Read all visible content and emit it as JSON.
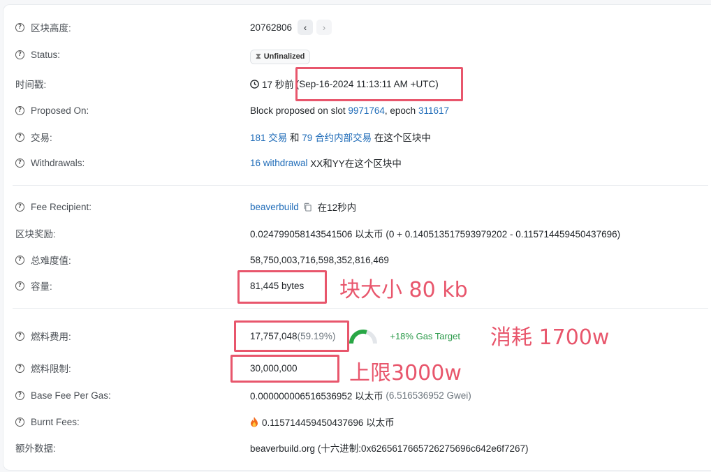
{
  "rows": {
    "block_height": {
      "label": "区块高度:",
      "value": "20762806",
      "prev_icon": "chevron-left-icon",
      "next_icon": "chevron-right-icon"
    },
    "status": {
      "label": "Status:",
      "badge": "Unfinalized",
      "badge_icon": "hourglass-icon"
    },
    "timestamp": {
      "label": "时间戳:",
      "ago": "17 秒前",
      "utc": "(Sep-16-2024 11:13:11 AM +UTC)"
    },
    "proposed_on": {
      "label": "Proposed On:",
      "prefix": "Block proposed on slot ",
      "slot": "9971764",
      "mid": ", epoch ",
      "epoch": "311617"
    },
    "transactions": {
      "label": "交易:",
      "tx_link": "181 交易",
      "and": " 和 ",
      "internal_link": "79 合约内部交易",
      "suffix": " 在这个区块中"
    },
    "withdrawals": {
      "label": "Withdrawals:",
      "link": "16 withdrawal",
      "suffix": " XX和YY在这个区块中"
    },
    "fee_recipient": {
      "label": "Fee Recipient:",
      "link": "beaverbuild",
      "suffix": " 在12秒内"
    },
    "block_reward": {
      "label": "区块奖励:",
      "value": "0.024799058143541506 以太币 (0 + 0.140513517593979202 - 0.115714459450437696)"
    },
    "total_difficulty": {
      "label": "总难度值:",
      "value": "58,750,003,716,598,352,816,469"
    },
    "size": {
      "label": "容量:",
      "value": "81,445 bytes"
    },
    "gas_used": {
      "label": "燃料费用:",
      "value": "17,757,048",
      "pct": "(59.19%)",
      "target": "+18% Gas Target",
      "gauge_fraction": 0.5919
    },
    "gas_limit": {
      "label": "燃料限制:",
      "value": "30,000,000"
    },
    "base_fee": {
      "label": "Base Fee Per Gas:",
      "value": "0.000000006516536952 以太币",
      "gwei": " (6.516536952 Gwei)"
    },
    "burnt_fees": {
      "label": "Burnt Fees:",
      "value": "0.115714459450437696 以太币",
      "icon": "fire-icon"
    },
    "extra_data": {
      "label": "额外数据:",
      "value": "beaverbuild.org (十六进制:0x6265617665726275696c642e6f7267)"
    }
  },
  "annotations": {
    "size": "块大小 80 kb",
    "gas_used": "消耗 1700w",
    "gas_limit": "上限3000w"
  },
  "colors": {
    "link": "#1e6bb8",
    "annotation": "#e8566c",
    "gauge": "#28a745",
    "gauge_track": "#e3e6ea"
  }
}
